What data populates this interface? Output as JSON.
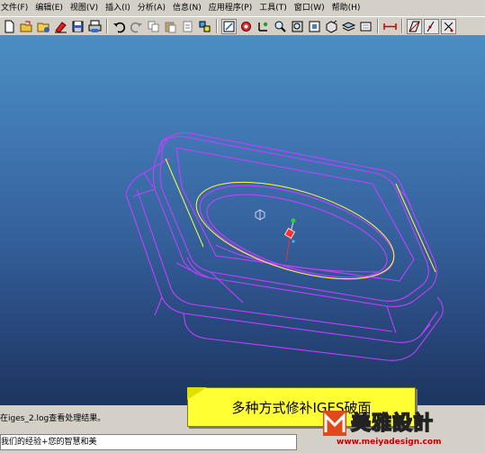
{
  "menubar": {
    "items": [
      {
        "label": "文件(F)"
      },
      {
        "label": "编辑(E)"
      },
      {
        "label": "视图(V)"
      },
      {
        "label": "插入(I)"
      },
      {
        "label": "分析(A)"
      },
      {
        "label": "信息(N)"
      },
      {
        "label": "应用程序(P)"
      },
      {
        "label": "工具(T)"
      },
      {
        "label": "窗口(W)"
      },
      {
        "label": "帮助(H)"
      }
    ]
  },
  "toolbar": {
    "icons": [
      "new-file-icon",
      "open-file-icon",
      "open-folder-icon",
      "erase-icon",
      "save-icon",
      "print-icon",
      "undo-icon",
      "redo-icon",
      "copy-icon",
      "paste-icon",
      "cut-icon",
      "regenerate-icon",
      "view-refit-icon",
      "spin-center-icon",
      "datum-axes-icon",
      "zoom-in-icon",
      "zoom-out-icon",
      "orient-icon",
      "saved-views-icon",
      "layers-icon",
      "datum-plane-icon",
      "datum-axis-icon",
      "datum-point-icon",
      "datum-csys-icon"
    ],
    "accent": "#c00000"
  },
  "viewport": {
    "gradient_top": "#4b8ec3",
    "gradient_bottom": "#1d355f",
    "wire_color": "#c040ff",
    "highlight_color": "#ffff40"
  },
  "messages": {
    "line1": "在iges_2.log查看处理结果。",
    "line2": "我们的经验+您的智慧和美"
  },
  "caption": {
    "text": "多种方式修补IGES破面",
    "background": "#ffff33"
  },
  "watermark": {
    "brand": "美雅設計",
    "url": "www.meiyadesign.com"
  }
}
